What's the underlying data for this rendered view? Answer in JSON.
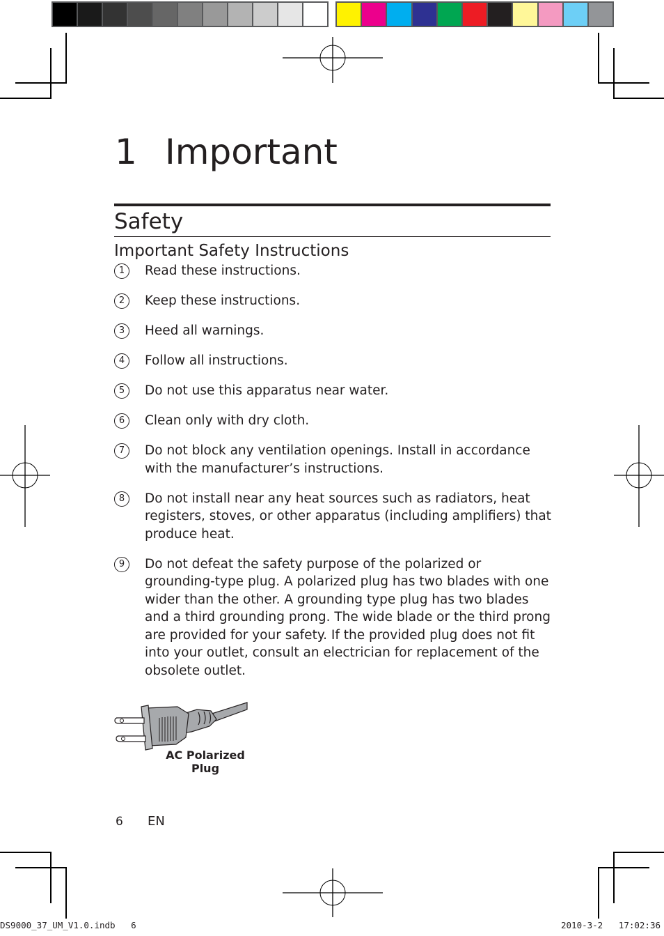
{
  "color_bars": {
    "grayscale": [
      "#000000",
      "#1a1a1a",
      "#333333",
      "#4d4d4d",
      "#666666",
      "#808080",
      "#999999",
      "#b3b3b3",
      "#cccccc",
      "#e6e6e6",
      "#ffffff"
    ],
    "process": [
      "#fff200",
      "#ec008c",
      "#00aeef",
      "#2e3192",
      "#00a651",
      "#ed1c24",
      "#231f20",
      "#fff799",
      "#f49ac1",
      "#6dcff6",
      "#939598"
    ]
  },
  "chapter": {
    "number": "1",
    "title": "Important"
  },
  "section": {
    "title": "Safety",
    "subtitle": "Important Safety Instructions"
  },
  "instructions": [
    {
      "num": "1",
      "text": "Read these instructions."
    },
    {
      "num": "2",
      "text": "Keep these instructions."
    },
    {
      "num": "3",
      "text": "Heed all warnings."
    },
    {
      "num": "4",
      "text": "Follow all instructions."
    },
    {
      "num": "5",
      "text": "Do not use this apparatus near water."
    },
    {
      "num": "6",
      "text": "Clean only with dry cloth."
    },
    {
      "num": "7",
      "text": "Do not block any ventilation openings. Install in accordance with the manufacturer’s instructions."
    },
    {
      "num": "8",
      "text": "Do not install near any heat sources such as radiators, heat registers, stoves, or other apparatus (including amplifiers) that produce heat."
    },
    {
      "num": "9",
      "text": "Do not defeat the safety purpose of the polarized or grounding-type plug. A polarized plug has two blades with one wider than the other. A grounding type plug has two blades and a third grounding prong. The wide blade or the third prong are provided for your safety. If the provided plug does not fit into your outlet, consult an electrician for replacement of the obsolete outlet."
    }
  ],
  "figure": {
    "icon": "ac-plug-icon",
    "caption_line1": "AC Polarized",
    "caption_line2": "Plug"
  },
  "footer": {
    "page_number": "6",
    "language": "EN"
  },
  "slug": {
    "file": "DS9000_37_UM_V1.0.indb   6",
    "date": "2010-3-2",
    "time": "17:02:36"
  }
}
